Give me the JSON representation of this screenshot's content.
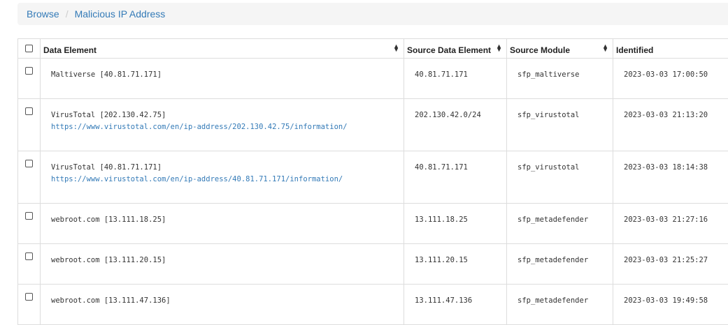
{
  "breadcrumb": {
    "items": [
      {
        "label": "Browse"
      },
      {
        "label": "Malicious IP Address"
      }
    ],
    "separator": "/"
  },
  "table": {
    "columns": [
      {
        "label": "Data Element"
      },
      {
        "label": "Source Data Element"
      },
      {
        "label": "Source Module"
      },
      {
        "label": "Identified"
      }
    ],
    "sort_icon": "sort-updown-icon",
    "rows": [
      {
        "data_element": "Maltiverse [40.81.71.171]",
        "link": "",
        "source": "40.81.71.171",
        "module": "sfp_maltiverse",
        "identified": "2023-03-03 17:00:50"
      },
      {
        "data_element": "VirusTotal [202.130.42.75]",
        "link": "https://www.virustotal.com/en/ip-address/202.130.42.75/information/",
        "source": "202.130.42.0/24",
        "module": "sfp_virustotal",
        "identified": "2023-03-03 21:13:20"
      },
      {
        "data_element": "VirusTotal [40.81.71.171]",
        "link": "https://www.virustotal.com/en/ip-address/40.81.71.171/information/",
        "source": "40.81.71.171",
        "module": "sfp_virustotal",
        "identified": "2023-03-03 18:14:38"
      },
      {
        "data_element": "webroot.com [13.111.18.25]",
        "link": "",
        "source": "13.111.18.25",
        "module": "sfp_metadefender",
        "identified": "2023-03-03 21:27:16"
      },
      {
        "data_element": "webroot.com [13.111.20.15]",
        "link": "",
        "source": "13.111.20.15",
        "module": "sfp_metadefender",
        "identified": "2023-03-03 21:25:27"
      },
      {
        "data_element": "webroot.com [13.111.47.136]",
        "link": "",
        "source": "13.111.47.136",
        "module": "sfp_metadefender",
        "identified": "2023-03-03 19:49:58"
      }
    ]
  },
  "colors": {
    "link": "#337ab7",
    "breadcrumb_bg": "#f5f5f5",
    "border": "#dddddd"
  }
}
